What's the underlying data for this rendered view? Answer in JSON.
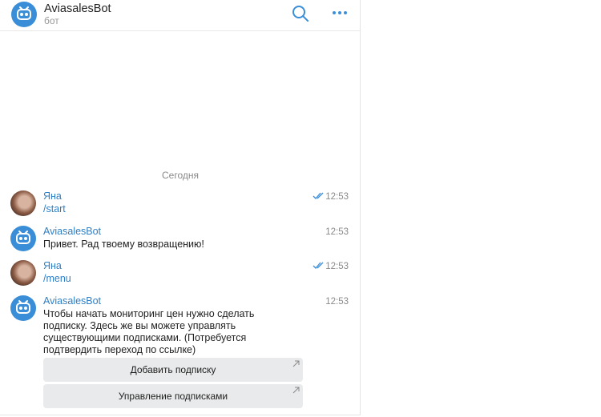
{
  "header": {
    "title": "AviasalesBot",
    "subtitle": "бот"
  },
  "date_separator": "Сегодня",
  "messages": [
    {
      "sender": "Яна",
      "text": "/start",
      "time": "12:53"
    },
    {
      "sender": "AviasalesBot",
      "text": "Привет. Рад твоему возвращению!",
      "time": "12:53"
    },
    {
      "sender": "Яна",
      "text": "/menu",
      "time": "12:53"
    },
    {
      "sender": "AviasalesBot",
      "text": "Чтобы начать мониторинг цен нужно сделать подписку. Здесь же вы можете управлять существующими подписками. (Потребуется подтвердить переход по ссылке)",
      "time": "12:53"
    }
  ],
  "keyboard": [
    {
      "label": "Добавить подписку"
    },
    {
      "label": "Управление подписками"
    }
  ],
  "colors": {
    "accent": "#3a8ed8",
    "link": "#2f7fc6"
  },
  "icons": {
    "search": "search-icon",
    "more": "more-icon",
    "bot": "bot-icon",
    "read": "double-check-icon",
    "external": "arrow-external-icon"
  }
}
